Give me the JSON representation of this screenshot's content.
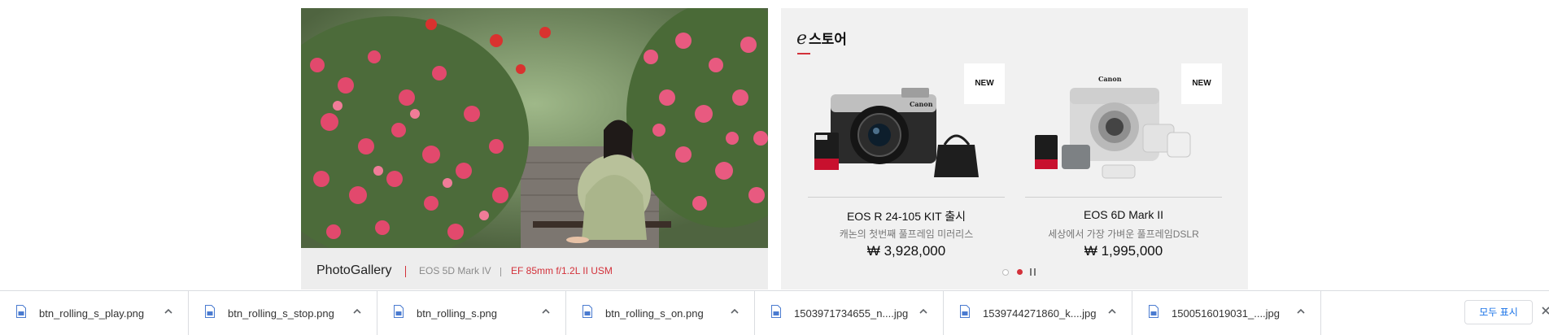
{
  "gallery": {
    "title": "PhotoGallery",
    "body": "EOS 5D Mark IV",
    "lens": "EF 85mm f/1.2L II USM"
  },
  "estore": {
    "logo_letter": "e",
    "title": "스토어",
    "products": [
      {
        "badge": "NEW",
        "name": "EOS R 24-105 KIT 출시",
        "desc": "캐논의 첫번째 풀프레임 미러리스",
        "price": "₩ 3,928,000"
      },
      {
        "badge": "NEW",
        "name": "EOS 6D Mark II",
        "desc": "세상에서 가장 가벼운 풀프레임DSLR",
        "price": "₩ 1,995,000"
      }
    ],
    "carousel": {
      "slides": 2,
      "active_index": 1
    }
  },
  "downloads": {
    "items": [
      {
        "name": "btn_rolling_s_play.png"
      },
      {
        "name": "btn_rolling_s_stop.png"
      },
      {
        "name": "btn_rolling_s.png"
      },
      {
        "name": "btn_rolling_s_on.png"
      },
      {
        "name": "1503971734655_n....jpg"
      },
      {
        "name": "1539744271860_k....jpg"
      },
      {
        "name": "1500516019031_....jpg"
      }
    ],
    "show_all_label": "모두 표시"
  },
  "colors": {
    "accent": "#d3313a",
    "link": "#1a73e8"
  }
}
